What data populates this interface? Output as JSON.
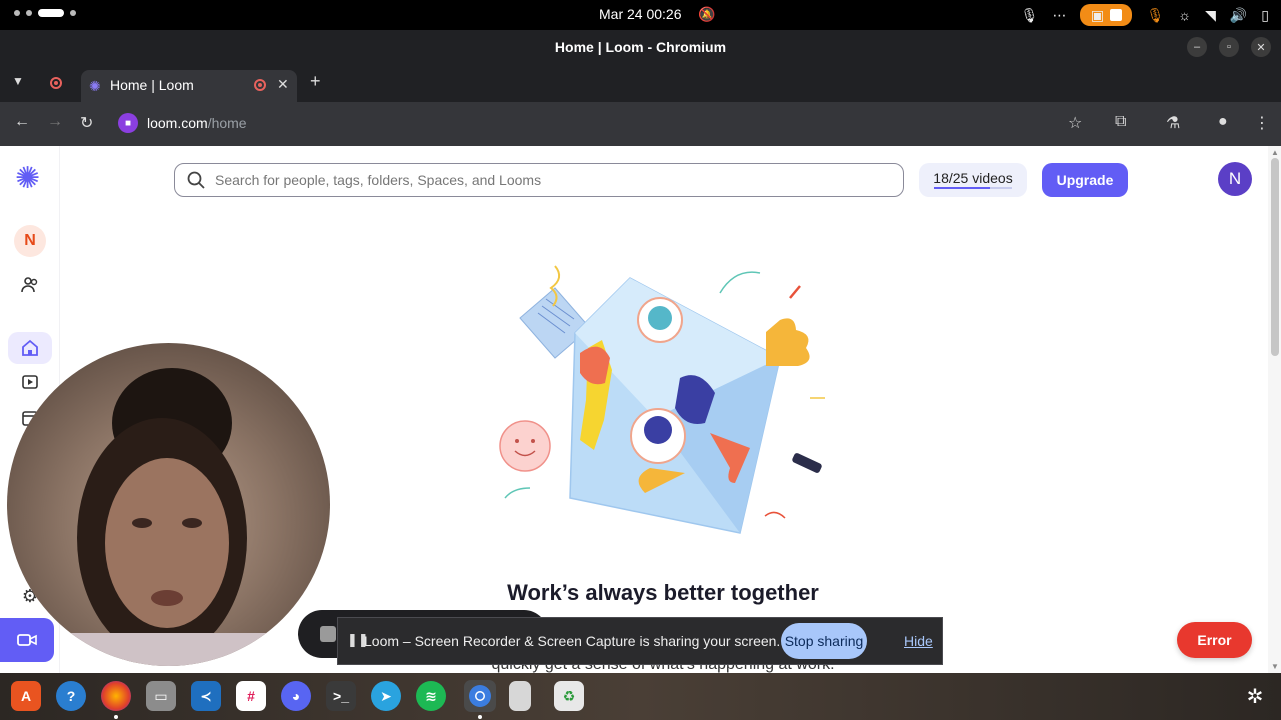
{
  "os": {
    "clock": "Mar 24  00:26"
  },
  "window": {
    "title": "Home | Loom - Chromium"
  },
  "tabs": [
    {
      "label": "Home | Loom",
      "active": true
    }
  ],
  "address": {
    "host": "loom.com",
    "path": "/home"
  },
  "loom": {
    "search_placeholder": "Search for people, tags, folders, Spaces, and Looms",
    "video_count": "18/25 videos",
    "video_progress": 0.72,
    "upgrade_label": "Upgrade",
    "user_initial": "N",
    "workspace_initial": "N",
    "headline": "Work’s always better together",
    "subline": "quickly get a sense of what’s happening at work.",
    "error_label": "Error"
  },
  "sharing": {
    "message": "Loom – Screen Recorder & Screen Capture is sharing your screen.",
    "stop_label": "Stop sharing",
    "hide_label": "Hide"
  },
  "colors": {
    "brand": "#625df5",
    "error": "#e8382e",
    "share_button": "#a8c7fa",
    "recording_indicator": "#f28c16"
  },
  "icons": {
    "rail": [
      "home-icon",
      "library-icon",
      "calendar-icon",
      "settings-icon",
      "record-camera-icon"
    ],
    "dock": [
      "app-center-icon",
      "help-icon",
      "firefox-icon",
      "files-icon",
      "vscode-icon",
      "slack-icon",
      "discord-icon",
      "terminal-icon",
      "telegram-icon",
      "spotify-icon",
      "chromium-icon",
      "removable-drive-icon",
      "trash-icon"
    ]
  }
}
